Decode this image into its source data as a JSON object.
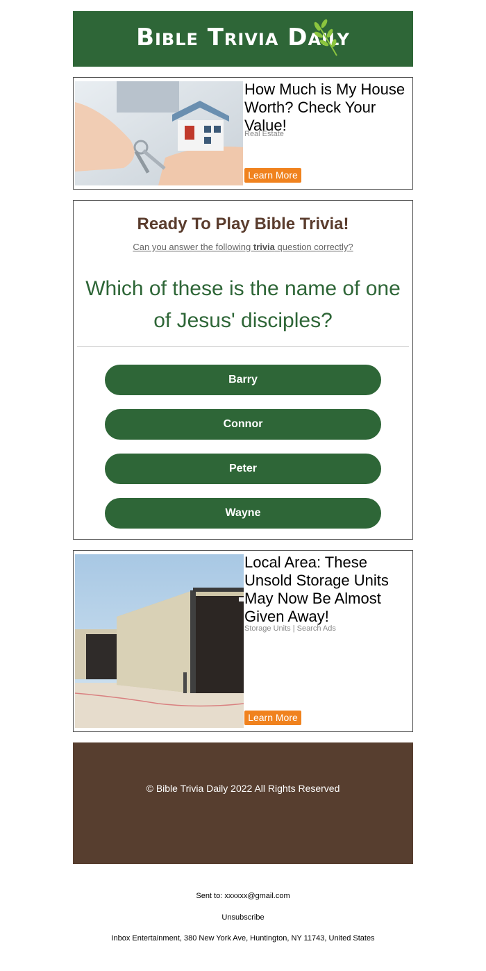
{
  "header": {
    "logo_text": "Bible Trivia Daily",
    "brand_color": "#2e6637"
  },
  "ad1": {
    "title": "How Much is My House Worth? Check Your Value!",
    "category": "Real Estate",
    "button_label": "Learn More",
    "image_icon": "house-keys-photo"
  },
  "trivia": {
    "heading": "Ready To Play Bible Trivia!",
    "subtitle_pre": "Can you answer the following ",
    "subtitle_bold": "trivia",
    "subtitle_post": " question correctly?",
    "question": "Which of these is the name of one of Jesus' disciples?",
    "answers": [
      "Barry",
      "Connor",
      "Peter",
      "Wayne"
    ]
  },
  "ad2": {
    "title": "Local Area: These Unsold Storage Units May Now Be Almost Given Away!",
    "category": "Storage Units | Search Ads",
    "button_label": "Learn More",
    "image_icon": "storage-units-photo"
  },
  "footer": {
    "copyright": "© Bible Trivia Daily 2022 All Rights Reserved",
    "background_color": "#573e2f"
  },
  "meta": {
    "sent_to": "Sent to: xxxxxx@gmail.com",
    "unsubscribe": "Unsubscribe",
    "address": "Inbox Entertainment, 380 New York Ave, Huntington, NY 11743, United States"
  },
  "accent_button_color": "#f0821e"
}
